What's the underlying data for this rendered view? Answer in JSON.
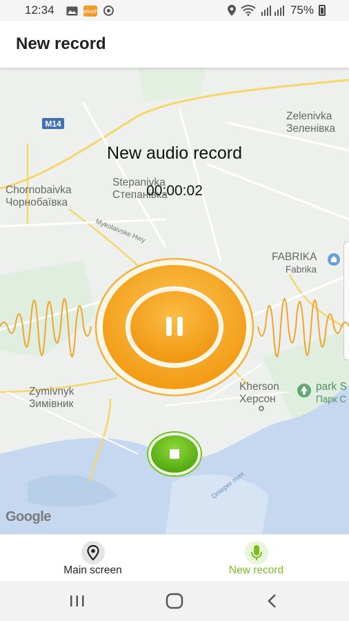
{
  "status_bar": {
    "time": "12:34",
    "battery": "75%"
  },
  "app_bar": {
    "title": "New record"
  },
  "recording": {
    "heading": "New audio record",
    "elapsed": "00:00:02"
  },
  "map": {
    "road_shield": "M14",
    "road_name": "Mykolaivske Hwy",
    "places": [
      {
        "line1": "Zelenivka",
        "line2": "Зеленівка"
      },
      {
        "line1": "Chornobaivka",
        "line2": "Чорнобаївка"
      },
      {
        "line1": "Stepanivka",
        "line2": "Степанівка"
      },
      {
        "line1": "FABRIKA",
        "line2": "Fabrika"
      },
      {
        "line1": "Zymivnyk",
        "line2": "Зимівник"
      },
      {
        "line1": "Kherson",
        "line2": "Херсон"
      },
      {
        "line1": "park S",
        "line2": "Парк С"
      }
    ],
    "river": "Dnieper river",
    "attribution": "Google"
  },
  "bottom_nav": {
    "main_label": "Main screen",
    "record_label": "New record",
    "active_color": "#7bbf1e",
    "inactive_color": "#222222"
  },
  "colors": {
    "accent_orange": "#f4a21d",
    "record_green": "#6cc21a"
  },
  "icons": [
    "image-icon",
    "weather-icon",
    "sync-icon",
    "location-icon",
    "wifi-icon",
    "signal-icon",
    "battery-icon",
    "place-icon",
    "mic-icon",
    "pause-icon",
    "stop-icon",
    "recents-icon",
    "home-icon",
    "back-icon"
  ]
}
